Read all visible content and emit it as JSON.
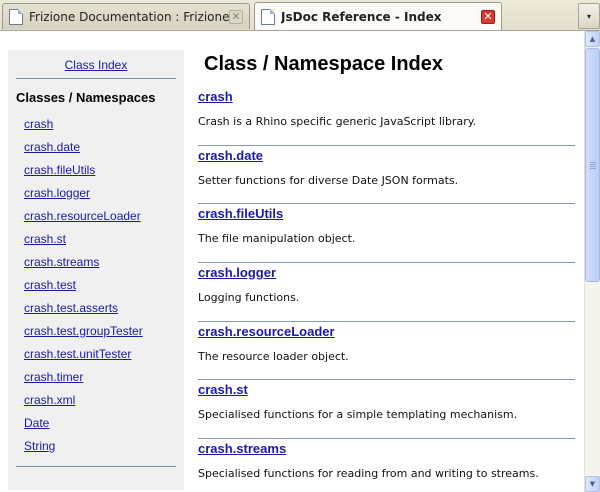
{
  "tabs": [
    {
      "title": "Frizione Documentation : Frizione Versi…",
      "close": "✕"
    },
    {
      "title": "JsDoc Reference - Index",
      "close": "✕"
    }
  ],
  "tab_menu_icon": "▾",
  "sidebar": {
    "class_index_link": "Class Index",
    "heading": "Classes / Namespaces",
    "items": [
      "crash",
      "crash.date",
      "crash.fileUtils",
      "crash.logger",
      "crash.resourceLoader",
      "crash.st",
      "crash.streams",
      "crash.test",
      "crash.test.asserts",
      "crash.test.groupTester",
      "crash.test.unitTester",
      "crash.timer",
      "crash.xml",
      "Date",
      "String"
    ]
  },
  "main": {
    "title": "Class / Namespace Index",
    "entries": [
      {
        "name": "crash",
        "desc": "Crash is a Rhino specific generic JavaScript library."
      },
      {
        "name": "crash.date",
        "desc": "Setter functions for diverse Date JSON formats."
      },
      {
        "name": "crash.fileUtils",
        "desc": "The file manipulation object."
      },
      {
        "name": "crash.logger",
        "desc": "Logging functions."
      },
      {
        "name": "crash.resourceLoader",
        "desc": "The resource loader object."
      },
      {
        "name": "crash.st",
        "desc": "Specialised functions for a simple templating mechanism."
      },
      {
        "name": "crash.streams",
        "desc": "Specialised functions for reading from and writing to streams."
      }
    ]
  },
  "scrollbar": {
    "up": "▲",
    "down": "▼"
  }
}
